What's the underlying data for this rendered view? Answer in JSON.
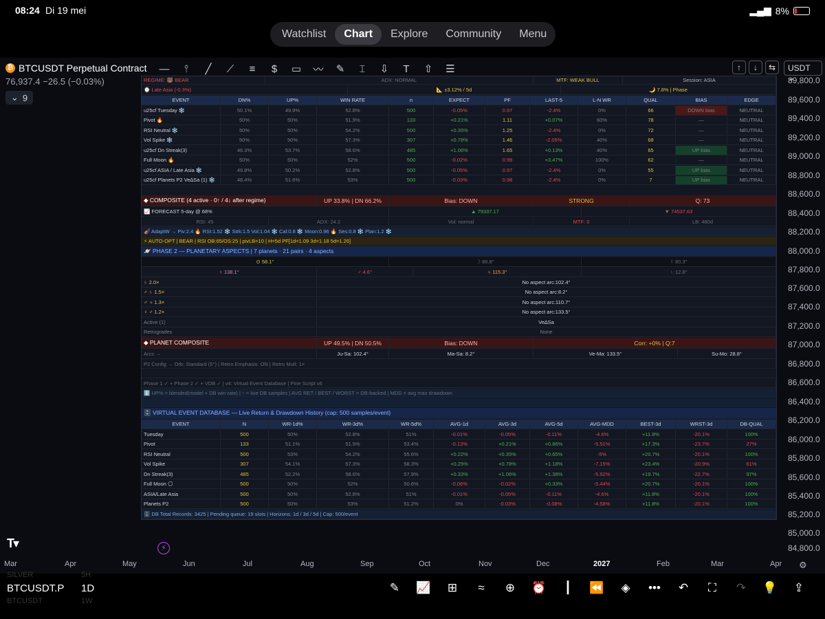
{
  "status": {
    "time": "08:24",
    "date": "Di 19 mei",
    "battery": "8%"
  },
  "nav": {
    "items": [
      "Watchlist",
      "Chart",
      "Explore",
      "Community",
      "Menu"
    ],
    "active": "Chart"
  },
  "symbol": {
    "name": "BTCUSDT Perpetual Contract",
    "price": "76,937.4",
    "change": "−26.5",
    "change_pct": "(−0.03%)",
    "count": "9"
  },
  "currency": "USDT",
  "yaxis": [
    "89,800.0",
    "89,600.0",
    "89,400.0",
    "89,200.0",
    "89,000.0",
    "88,800.0",
    "88,600.0",
    "88,400.0",
    "88,200.0",
    "88,000.0",
    "87,800.0",
    "87,600.0",
    "87,400.0",
    "87,200.0",
    "87,000.0",
    "86,800.0",
    "86,600.0",
    "86,400.0",
    "86,200.0",
    "86,000.0",
    "85,800.0",
    "85,600.0",
    "85,400.0",
    "85,200.0",
    "85,000.0",
    "84,800.0"
  ],
  "xaxis": [
    "Mar",
    "Apr",
    "May",
    "Jun",
    "Jul",
    "Aug",
    "Sep",
    "Oct",
    "Nov",
    "Dec",
    "2027",
    "Feb",
    "Mar",
    "Apr"
  ],
  "panel": {
    "top": {
      "regime": "REGIME: 🐻 BEAR",
      "adx": "ADX: NORMAL",
      "mtf": "MTF: WEAK BULL",
      "session": "Session: ASIA"
    },
    "row2": {
      "late": "⌚ Late Asia  (-0.3%)",
      "range": "📐 ±3.12% / 5d",
      "phase": "🌙 7.8% | Phase"
    },
    "ev_headers": [
      "EVENT",
      "DN%",
      "UP%",
      "WIN RATE",
      "n",
      "EXPECT",
      "PF",
      "LAST-5",
      "L-N WR",
      "QUAL",
      "BIAS",
      "EDGE"
    ],
    "ev_rows": [
      [
        "u25cf Tuesday ❄️",
        "50.1%",
        "49.9%",
        "52.8%",
        "500",
        "-0.05%",
        "0.97",
        "-2.4%",
        "0%",
        "66",
        "DOWN bias",
        "NEUTRAL"
      ],
      [
        "Pivot 🔥",
        "50%",
        "50%",
        "51.9%",
        "133",
        "+0.21%",
        "1.11",
        "+0.07%",
        "60%",
        "78",
        "—",
        "NEUTRAL"
      ],
      [
        "RSI Neutral ❄️",
        "50%",
        "50%",
        "54.2%",
        "500",
        "+0.35%",
        "1.25",
        "-2.4%",
        "0%",
        "72",
        "—",
        "NEUTRAL"
      ],
      [
        "Vol Spike ❄️",
        "50%",
        "50%",
        "57.3%",
        "307",
        "+0.78%",
        "1.46",
        "-2.05%",
        "40%",
        "68",
        "—",
        "NEUTRAL"
      ],
      [
        "u25cf Dn Streak(3)",
        "46.3%",
        "53.7%",
        "58.6%",
        "485",
        "+1.06%",
        "1.65",
        "+0.13%",
        "40%",
        "65",
        "UP bias",
        "NEUTRAL"
      ],
      [
        "Full Moon 🔥",
        "50%",
        "50%",
        "52%",
        "500",
        "-0.02%",
        "0.99",
        "+3.47%",
        "100%",
        "62",
        "—",
        "NEUTRAL"
      ],
      [
        "u25cf ASIA / Late Asia ❄️",
        "49.8%",
        "50.2%",
        "52.8%",
        "500",
        "-0.05%",
        "0.97",
        "-2.4%",
        "0%",
        "55",
        "UP bias",
        "NEUTRAL"
      ],
      [
        "u25cf Planets P2 Ve∆Sa (1) ❄️",
        "48.4%",
        "51.6%",
        "53%",
        "500",
        "-0.03%",
        "0.98",
        "-2.4%",
        "0%",
        "7",
        "UP bias",
        "NEUTRAL"
      ]
    ],
    "composite": {
      "title": "◆ COMPOSITE  (4 active · 0↑ / 4↓ after regime)",
      "updn": "UP 33.8%  |  DN 66.2%",
      "bias": "Bias: DOWN",
      "strength": "STRONG",
      "q": "Q: 73"
    },
    "forecast": {
      "label": "📈 FORECAST  5-day @ 68%",
      "up": "▲ 79337.17",
      "dn": "▼ 74537.63"
    },
    "stats": {
      "rsi": "RSI: 45",
      "adx": "ADX: 24.2",
      "vol": "Vol: normal",
      "mtf": "MTF: 0",
      "lb": "LB: 480d"
    },
    "adapt": "🎻 AdaptW → Piv:2.4 🔥  RSI:1.52 ❄️  Strk:1.5  Vol:1.04 ❄️  Cal:0.8 ❄️  Moon:0.96 🔥  Ses:0.8 ❄️  Plan:1.2 ❄️",
    "autoopt": "⚡ AUTO-OPT | BEAR | RSI OB:65/OS:25  |  pivLB=10  |  H=5d PF[1d=1.09 3d=1.18 5d=1.26]",
    "phase2": "🪐 PHASE 2 — PLANETARY ASPECTS  |  7 planets · 21 pairs · 4 aspects",
    "planets_row1": [
      "⊙ 58.1°",
      "☽ 86.8°",
      "☿ 80.3°"
    ],
    "planets_row2": [
      "♀ 138.1°",
      "♂ 4.6°",
      "♃ 115.3°",
      "♄ 12.8°"
    ],
    "aspects": [
      {
        "l": "♄  2.0×",
        "r": "No aspect  arc:102.4°"
      },
      {
        "l": "♂ ♄  1.5×",
        "r": "No aspect  arc:8.2°"
      },
      {
        "l": "♂ ♃  1.3×",
        "r": "No aspect  arc:110.7°"
      },
      {
        "l": "♀ ♂   1.2×",
        "r": "No aspect  arc:133.5°"
      },
      {
        "l": "Active (1)",
        "r": "Ve∆Sa"
      },
      {
        "l": "Retrogrades",
        "r": "None"
      }
    ],
    "planet_comp": {
      "title": "◆ PLANET COMPOSITE",
      "updn": "UP 49.5%  |  DN 50.5%",
      "bias": "Bias: DOWN",
      "corr": "Corr: +0% | Q:7"
    },
    "arcs": [
      "Arcs →",
      "Ju-Sa: 102.4°",
      "Ma-Sa: 8.2°",
      "Ve-Ma: 133.5°",
      "Su-Mo: 28.8°"
    ],
    "p2config": "P2 Config → Orb: Standard (5°)  |  Retro Emphasis: ON  |  Retro Mult: 1×",
    "phase_line": "Phase 1 ✓ + Phase 2 ✓ + VDB ✓  |  v4: Virtual Event Database  |  Pine Script v6",
    "legend_line": "ℹ️  UP% = blended(model + DB win-rate)  |  ↑ = live DB samples  |  AVG RET / BEST / WORST = DB-backed  |  MDD = avg max drawdown",
    "vdb_title": "🗄️ VIRTUAL EVENT DATABASE  —  Live Return & Drawdown History  (cap: 500 samples/event)",
    "vdb_headers": [
      "EVENT",
      "N",
      "WR-1d%",
      "WR-3d%",
      "WR-5d%",
      "AVG-1d",
      "AVG-3d",
      "AVG-5d",
      "AVG-MDD",
      "BEST-3d",
      "WRST-3d",
      "DB-QUAL"
    ],
    "vdb_rows": [
      [
        "Tuesday",
        "500",
        "50%",
        "52.8%",
        "51%",
        "-0.01%",
        "-0.05%",
        "-0.11%",
        "-4.6%",
        "+11.8%",
        "-20.1%",
        "100%"
      ],
      [
        "Pivot",
        "133",
        "51.1%",
        "51.9%",
        "53.4%",
        "-0.13%",
        "+0.21%",
        "+0.86%",
        "-5.51%",
        "+17.3%",
        "-23.7%",
        "27%"
      ],
      [
        "RSI Neutral",
        "500",
        "53%",
        "54.2%",
        "55.6%",
        "+0.22%",
        "+0.35%",
        "+0.65%",
        "-5%",
        "+20.7%",
        "-20.1%",
        "100%"
      ],
      [
        "Vol Spike",
        "307",
        "54.1%",
        "57.3%",
        "58.3%",
        "+0.25%",
        "+0.78%",
        "+1.18%",
        "-7.15%",
        "+23.4%",
        "-20.9%",
        "61%"
      ],
      [
        "Dn Streak(3)",
        "485",
        "52.2%",
        "58.6%",
        "57.9%",
        "+0.33%",
        "+1.06%",
        "+1.38%",
        "-5.92%",
        "+19.7%",
        "-22.7%",
        "97%"
      ],
      [
        "Full Moon 🌕",
        "500",
        "50%",
        "52%",
        "50.6%",
        "-0.06%",
        "-0.02%",
        "+0.33%",
        "-5.44%",
        "+20.7%",
        "-20.1%",
        "100%"
      ],
      [
        "ASIA/Late Asia",
        "500",
        "50%",
        "52.8%",
        "51%",
        "-0.01%",
        "-0.05%",
        "-0.11%",
        "-4.6%",
        "+11.8%",
        "-20.1%",
        "100%"
      ],
      [
        "Planets P2",
        "500",
        "50%",
        "53%",
        "51.2%",
        "0%",
        "-0.03%",
        "-0.08%",
        "-4.58%",
        "+11.8%",
        "-20.1%",
        "100%"
      ]
    ],
    "db_footer": "🗄️ DB Total Records: 3425  |  Pending queue: 19 slots  |  Horizons: 1d / 3d / 5d  |  Cap: 500/event"
  },
  "bottom": {
    "symbol": "BTCUSDT.P",
    "interval": "1D",
    "ghost1": "SILVER",
    "ghost2": "5H",
    "ghost3": "BTCUSDT",
    "ghost4": "1W"
  }
}
